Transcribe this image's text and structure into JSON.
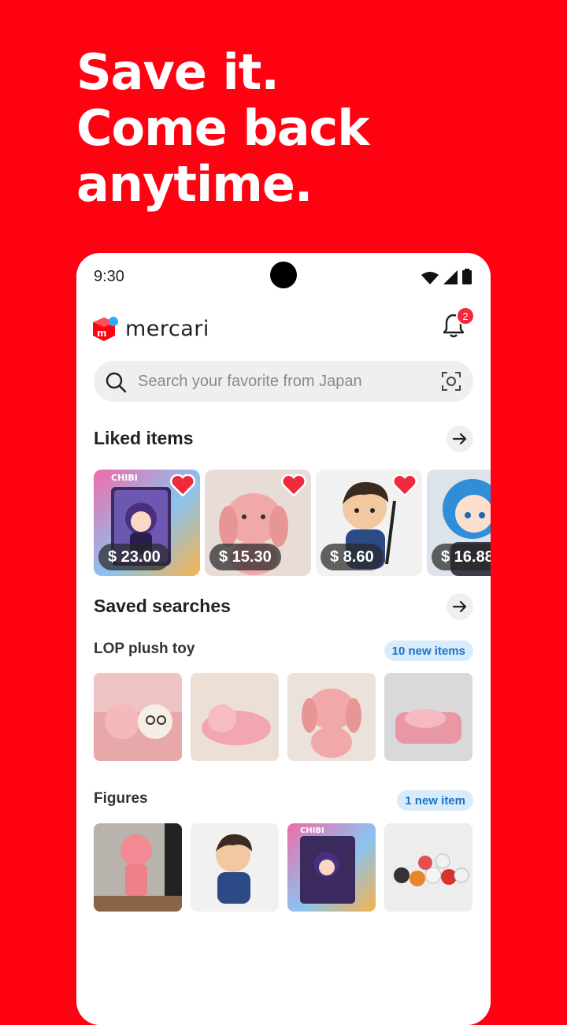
{
  "headline": [
    "Save it.",
    "Come back",
    "anytime."
  ],
  "status_bar": {
    "time": "9:30"
  },
  "app": {
    "logo_text": "mercari",
    "notification_count": "2"
  },
  "search": {
    "placeholder": "Search your favorite from Japan"
  },
  "liked": {
    "title": "Liked items",
    "items": [
      {
        "price": "$ 23.00",
        "image": "chibi-figure-box"
      },
      {
        "price": "$ 15.30",
        "image": "pink-plush-dog"
      },
      {
        "price": "$ 8.60",
        "image": "samurai-figure"
      },
      {
        "price": "$ 16.88",
        "image": "blue-hair-figure"
      }
    ]
  },
  "saved": {
    "title": "Saved searches",
    "groups": [
      {
        "name": "LOP plush toy",
        "badge": "10 new items"
      },
      {
        "name": "Figures",
        "badge": "1 new item"
      }
    ]
  },
  "colors": {
    "brand_red": "#ff0211",
    "heart_red": "#ee2a3c",
    "pill_bg": "#d8ecfb",
    "pill_text": "#1a72c9"
  },
  "icons": [
    "search-icon",
    "scan-icon",
    "bell-icon",
    "arrow-right-icon",
    "heart-icon",
    "wifi-icon",
    "signal-icon",
    "battery-icon"
  ]
}
